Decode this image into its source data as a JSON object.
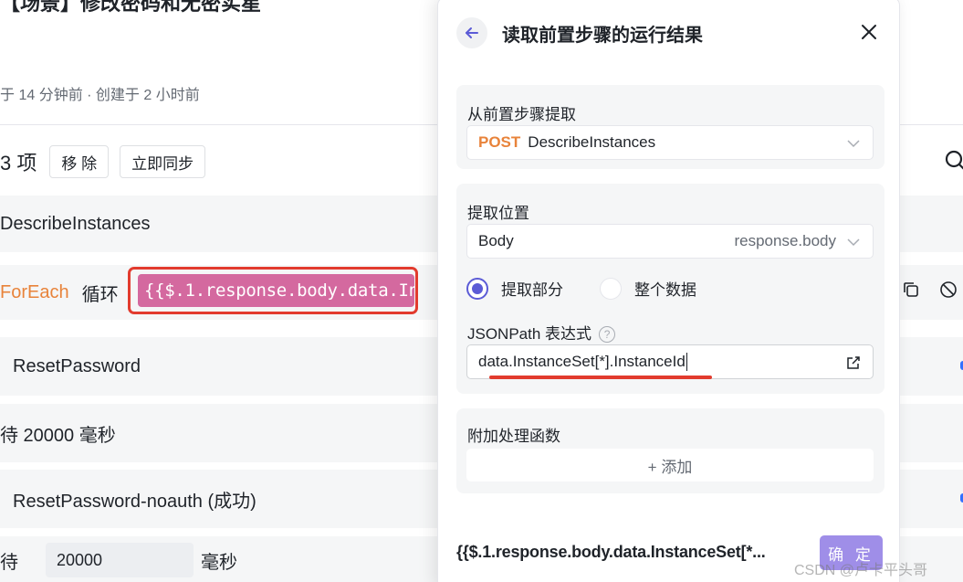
{
  "background": {
    "title": "【场景】修改密码和无密实星",
    "meta": "于 14 分钟前 · 创建于 2 小时前",
    "toolbar": {
      "count": "3 项",
      "remove": "移 除",
      "sync": "立即同步"
    },
    "rows": {
      "describe": "DescribeInstances",
      "foreach_keyword": "ForEach",
      "loop_label": "循环",
      "loop_expr": "{{$.1.response.body.data.In...",
      "reset": "ResetPassword",
      "wait1": "待 20000 毫秒",
      "reset_noauth": "ResetPassword-noauth (成功)",
      "wait2_prefix": "待",
      "wait2_value": "20000",
      "wait2_unit": "毫秒"
    }
  },
  "panel": {
    "title": "读取前置步骤的运行结果",
    "source": {
      "label": "从前置步骤提取",
      "method": "POST",
      "step": "DescribeInstances"
    },
    "position": {
      "label": "提取位置",
      "value": "Body",
      "hint": "response.body",
      "radio_partial": "提取部分",
      "radio_whole": "整个数据",
      "jsonpath_label": "JSONPath 表达式",
      "jsonpath_value": "data.InstanceSet[*].InstanceId"
    },
    "postprocess": {
      "label": "附加处理函数",
      "add": "+ 添加"
    },
    "footer_expr": "{{$.1.response.body.data.InstanceSet[*...",
    "confirm": "确 定"
  },
  "watermark": "CSDN @卢卡平头哥",
  "colors": {
    "accent": "#5b5bd6",
    "method": "#e8833a",
    "highlight": "#e23b2e",
    "pill": "#d4699f"
  }
}
